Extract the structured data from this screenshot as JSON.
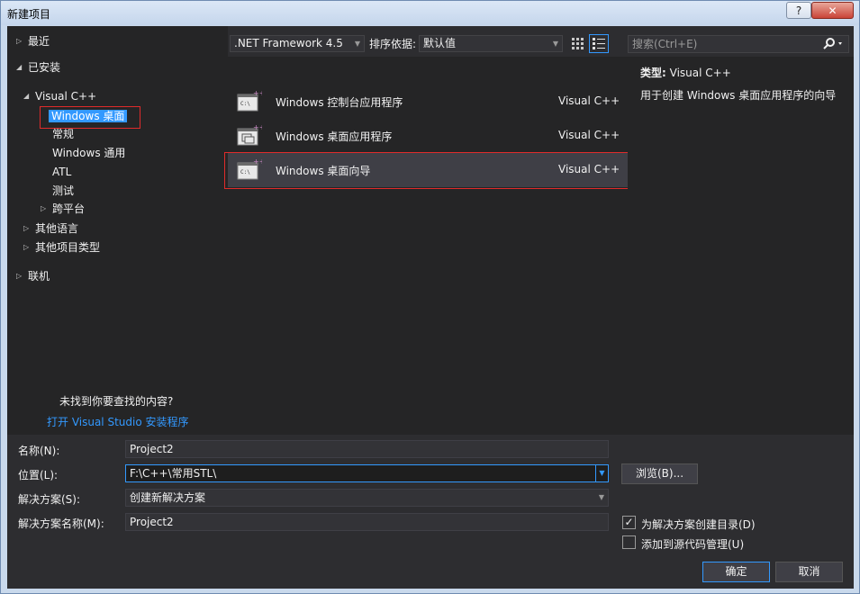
{
  "window": {
    "title": "新建项目",
    "help_label": "?",
    "close_label": "✕"
  },
  "tree": {
    "recent": "最近",
    "installed": "已安装",
    "visual_cpp": "Visual C++",
    "windows_desktop": "Windows 桌面",
    "general": "常规",
    "windows_universal": "Windows 通用",
    "atl": "ATL",
    "test": "测试",
    "cross_platform": "跨平台",
    "other_languages": "其他语言",
    "other_project_types": "其他项目类型",
    "online": "联机",
    "not_found": "未找到你要查找的内容?",
    "install_link": "打开 Visual Studio 安装程序"
  },
  "toolbar": {
    "framework": ".NET Framework 4.5",
    "sort_label": "排序依据:",
    "sort_value": "默认值",
    "search_placeholder": "搜索(Ctrl+E)"
  },
  "templates": [
    {
      "name": "Windows 控制台应用程序",
      "lang": "Visual C++",
      "icon": "console-app-icon"
    },
    {
      "name": "Windows 桌面应用程序",
      "lang": "Visual C++",
      "icon": "desktop-app-icon"
    },
    {
      "name": "Windows 桌面向导",
      "lang": "Visual C++",
      "icon": "desktop-wizard-icon"
    }
  ],
  "description": {
    "type_label": "类型:",
    "type_value": "Visual C++",
    "text": "用于创建 Windows 桌面应用程序的向导"
  },
  "form": {
    "name_label": "名称(N):",
    "name_value": "Project2",
    "location_label": "位置(L):",
    "location_value": "F:\\C++\\常用STL\\",
    "solution_label": "解决方案(S):",
    "solution_value": "创建新解决方案",
    "solution_name_label": "解决方案名称(M):",
    "solution_name_value": "Project2",
    "browse_label": "浏览(B)...",
    "create_dir_label": "为解决方案创建目录(D)",
    "create_dir_checked": true,
    "source_control_label": "添加到源代码管理(U)",
    "source_control_checked": false,
    "ok_label": "确定",
    "cancel_label": "取消"
  },
  "colors": {
    "accent": "#3399ff",
    "highlight_box": "#e02b2b",
    "background": "#2d2d30"
  }
}
